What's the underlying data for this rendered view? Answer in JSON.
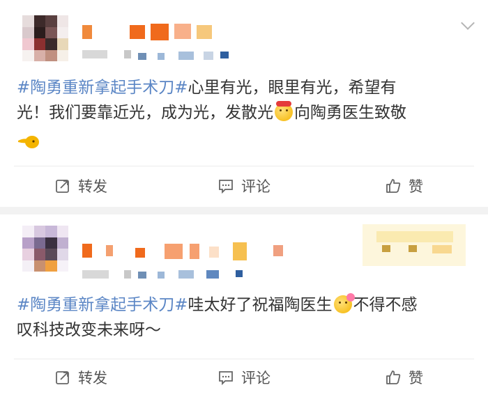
{
  "posts": [
    {
      "topic": "#陶勇重新拿起手术刀#",
      "line1_rest": "心里有光，眼里有光，希望有",
      "line2_a": "光！我们要靠近光，成为光，发散光",
      "line2_b": "向陶勇医生致敬",
      "emoji": "celebrate-emoji",
      "emoji2": "hand-emoji",
      "repost_label": "转发",
      "comment_label": "评论",
      "like_label": "赞"
    },
    {
      "topic": "#陶勇重新拿起手术刀#",
      "line1_rest": "哇太好了祝福陶医生",
      "line1_b": "不得不感",
      "line2": "叹科技改变未来呀～",
      "emoji": "flower-smile-emoji",
      "repost_label": "转发",
      "comment_label": "评论",
      "like_label": "赞"
    }
  ],
  "colors": {
    "topic": "#5b86c5",
    "text": "#333333",
    "action": "#555555",
    "background": "#f2f2f2"
  }
}
